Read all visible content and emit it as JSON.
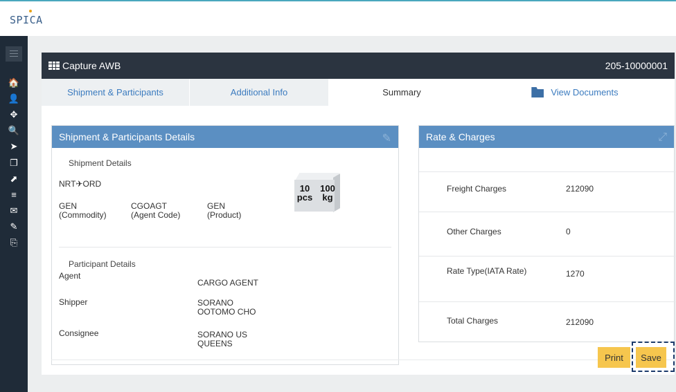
{
  "app": {
    "logo": "SPICA"
  },
  "sidebar": {
    "items": [
      {
        "icon": "home-icon",
        "glyph": "🏠"
      },
      {
        "icon": "user-icon",
        "glyph": "👤"
      },
      {
        "icon": "move-icon",
        "glyph": "✥"
      },
      {
        "icon": "search-icon",
        "glyph": "🔍"
      },
      {
        "icon": "send-icon",
        "glyph": "➤"
      },
      {
        "icon": "copy-icon",
        "glyph": "❐"
      },
      {
        "icon": "external-link-icon",
        "glyph": "⬈"
      },
      {
        "icon": "list-icon",
        "glyph": "≡"
      },
      {
        "icon": "mail-icon",
        "glyph": "✉"
      },
      {
        "icon": "edit-icon",
        "glyph": "✎"
      },
      {
        "icon": "pdf-icon",
        "glyph": "⎘"
      }
    ]
  },
  "header": {
    "title": "Capture AWB",
    "awb_number": "205-10000001"
  },
  "tabs": [
    {
      "label": "Shipment & Participants"
    },
    {
      "label": "Additional Info"
    },
    {
      "label": "Summary"
    },
    {
      "label": "View Documents"
    }
  ],
  "shipment_card": {
    "title": "Shipment & Participants Details",
    "shipment_section": "Shipment Details",
    "route": "NRT✈ORD",
    "pieces": "10",
    "pieces_unit": "pcs",
    "weight": "100",
    "weight_unit": "kg",
    "commodity_value": "GEN",
    "commodity_label": "(Commodity)",
    "agent_code_value": "CGOAGT",
    "agent_code_label": "(Agent Code)",
    "product_value": "GEN",
    "product_label": "(Product)",
    "participant_section": "Participant Details",
    "agent_label": "Agent",
    "agent_value": "CARGO AGENT",
    "shipper_label": "Shipper",
    "shipper_value_1": "SORANO",
    "shipper_value_2": "OOTOMO CHO",
    "consignee_label": "Consignee",
    "consignee_value_1": "SORANO US",
    "consignee_value_2": "QUEENS"
  },
  "rates_card": {
    "title": "Rate & Charges",
    "rows": [
      {
        "label": "Freight Charges",
        "value": "212090"
      },
      {
        "label": "Other Charges",
        "value": "0"
      },
      {
        "label": "Rate Type(IATA Rate)",
        "value": "1270"
      },
      {
        "label": "Total Charges",
        "value": "212090"
      }
    ]
  },
  "actions": {
    "print": "Print",
    "save": "Save"
  }
}
